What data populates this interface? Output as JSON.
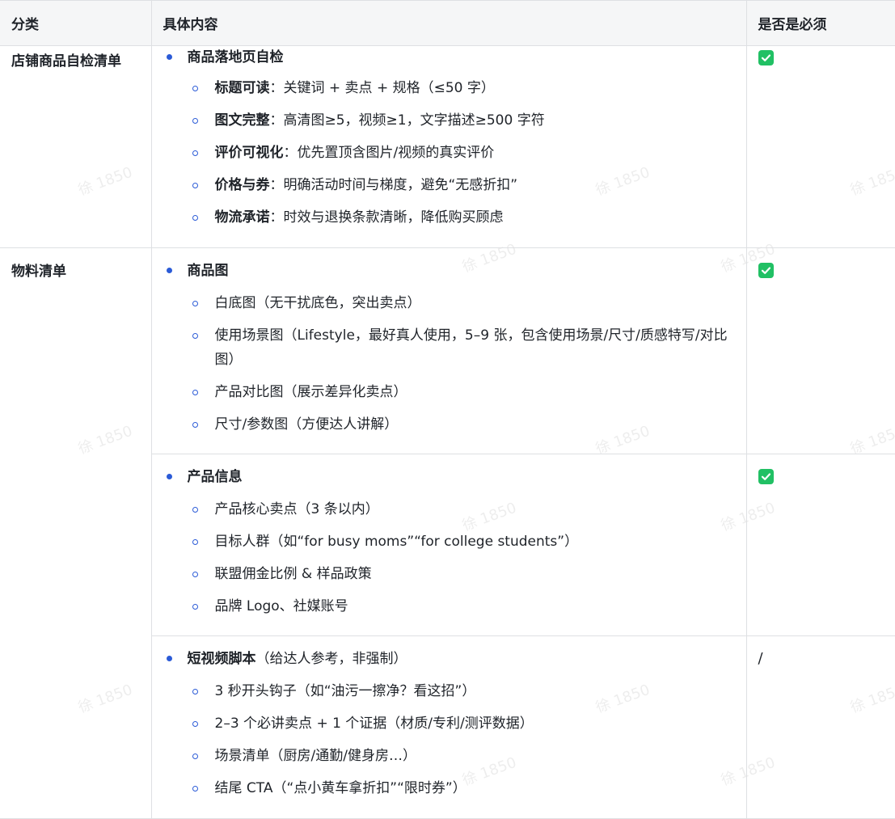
{
  "table": {
    "headers": [
      "分类",
      "具体内容",
      "是否是必须"
    ],
    "rows": [
      {
        "category": "店铺商品自检清单",
        "title": "商品落地页自检",
        "title_note": "",
        "required": "check",
        "items": [
          {
            "bold": "标题可读",
            "text": "：关键词 + 卖点 + 规格（≤50 字）"
          },
          {
            "bold": "图文完整",
            "text": "：高清图≥5，视频≥1，文字描述≥500 字符"
          },
          {
            "bold": "评价可视化",
            "text": "：优先置顶含图片/视频的真实评价"
          },
          {
            "bold": "价格与券",
            "text": "：明确活动时间与梯度，避免“无感折扣”"
          },
          {
            "bold": "物流承诺",
            "text": "：时效与退换条款清晰，降低购买顾虑"
          }
        ]
      },
      {
        "category": "物料清单",
        "title": "商品图",
        "title_note": "",
        "required": "check",
        "items": [
          {
            "bold": "",
            "text": "白底图（无干扰底色，突出卖点）"
          },
          {
            "bold": "",
            "text": "使用场景图（Lifestyle，最好真人使用，5–9 张，包含使用场景/尺寸/质感特写/对比图）"
          },
          {
            "bold": "",
            "text": "产品对比图（展示差异化卖点）"
          },
          {
            "bold": "",
            "text": "尺寸/参数图（方便达人讲解）"
          }
        ]
      },
      {
        "category": "",
        "title": "产品信息",
        "title_note": "",
        "required": "check",
        "items": [
          {
            "bold": "",
            "text": "产品核心卖点（3 条以内）"
          },
          {
            "bold": "",
            "text": "目标人群（如“for busy moms”“for college students”）"
          },
          {
            "bold": "",
            "text": "联盟佣金比例 & 样品政策"
          },
          {
            "bold": "",
            "text": "品牌 Logo、社媒账号"
          }
        ]
      },
      {
        "category": "",
        "title": "短视频脚本",
        "title_note": "（给达人参考，非强制）",
        "required": "/",
        "items": [
          {
            "bold": "",
            "text": "3 秒开头钩子（如“油污一擦净？看这招”）"
          },
          {
            "bold": "",
            "text": "2–3 个必讲卖点 + 1 个证据（材质/专利/测评数据）"
          },
          {
            "bold": "",
            "text": "场景清单（厨房/通勤/健身房…）"
          },
          {
            "bold": "",
            "text": "结尾 CTA（“点小黄车拿折扣”“限时券”）"
          }
        ]
      }
    ]
  },
  "watermark": "徐 1850",
  "icons": {
    "required_mark": "check-square-icon"
  },
  "colors": {
    "check": "#21c064",
    "bullet": "#2b5bd7",
    "header_bg": "#f5f6f7",
    "border": "#dee0e3"
  }
}
